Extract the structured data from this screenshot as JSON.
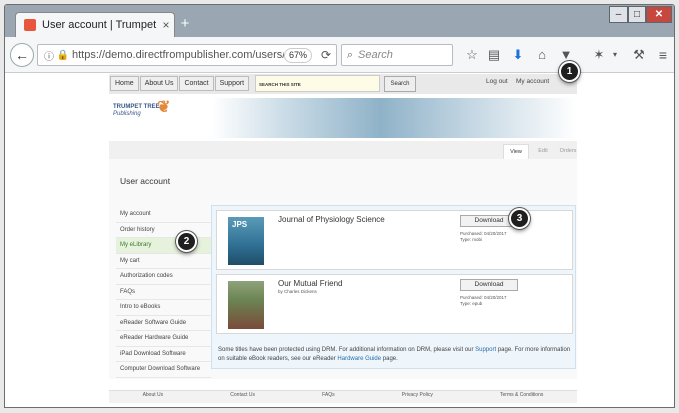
{
  "browser": {
    "tab_title": "User account | Trumpet Tre...",
    "tab_close": "×",
    "new_tab": "+",
    "url": "https://demo.directfrompublisher.com/users/rach",
    "zoom": "67%",
    "search_placeholder": "Search"
  },
  "site": {
    "topnav": [
      "Home",
      "About Us",
      "Contact",
      "Support"
    ],
    "search_label": "SEARCH THIS SITE",
    "search_button": "Search",
    "logout": "Log out",
    "my_account": "My account",
    "logo_line1": "TRUMPET TREE",
    "logo_line2": "Publishing"
  },
  "page": {
    "title": "User account",
    "view_tabs": [
      "View",
      "Edit",
      "Orders"
    ],
    "sidebar": [
      "My account",
      "Order history",
      "My eLibrary",
      "My cart",
      "Authorization codes",
      "FAQs",
      "Intro to eBooks",
      "eReader Software Guide",
      "eReader Hardware Guide",
      "iPad Download Software",
      "Computer Download Software"
    ]
  },
  "books": [
    {
      "cover_text": "JPS",
      "title": "Journal of Physiology Science",
      "author": "",
      "button": "Download",
      "purchased": "Purchased: 04/20/2017",
      "type": "Type: mobi"
    },
    {
      "cover_text": "",
      "title": "Our Mutual Friend",
      "author": "by Charles Dickens",
      "button": "Download",
      "purchased": "Purchased: 04/20/2017",
      "type": "Type: epub"
    }
  ],
  "note": {
    "part1": "Some titles have been protected using DRM. For additional information on DRM, please visit our ",
    "link1": "Support",
    "part2": " page. For more information on suitable eBook readers, see our eReader ",
    "link2": "Hardware Guide",
    "part3": " page."
  },
  "footer": [
    "About Us",
    "Contact Us",
    "FAQs",
    "Privacy Policy",
    "Terms & Conditions"
  ],
  "markers": [
    "1",
    "2",
    "3"
  ]
}
